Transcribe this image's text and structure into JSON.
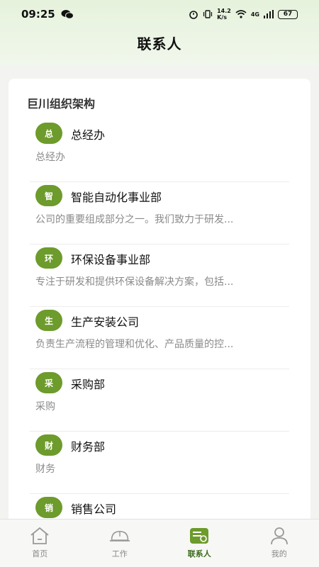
{
  "status": {
    "time": "09:25",
    "speed": "14.2\nK/s",
    "network": "4G",
    "battery": "67"
  },
  "header": {
    "title": "联系人"
  },
  "org": {
    "title": "巨川组织架构",
    "items": [
      {
        "badge": "总",
        "name": "总经办",
        "desc": "总经办"
      },
      {
        "badge": "智",
        "name": "智能自动化事业部",
        "desc": "公司的重要组成部分之一。我们致力于研发..."
      },
      {
        "badge": "环",
        "name": "环保设备事业部",
        "desc": "专注于研发和提供环保设备解决方案，包括..."
      },
      {
        "badge": "生",
        "name": "生产安装公司",
        "desc": "负责生产流程的管理和优化、产品质量的控..."
      },
      {
        "badge": "采",
        "name": "采购部",
        "desc": "采购"
      },
      {
        "badge": "财",
        "name": "财务部",
        "desc": "财务"
      },
      {
        "badge": "销",
        "name": "销售公司",
        "desc": ""
      }
    ]
  },
  "tabbar": {
    "tabs": [
      {
        "label": "首页",
        "icon": "home-icon"
      },
      {
        "label": "工作",
        "icon": "helmet-icon"
      },
      {
        "label": "联系人",
        "icon": "contacts-icon"
      },
      {
        "label": "我的",
        "icon": "user-icon"
      }
    ],
    "active": "联系人",
    "accent": "#6d9b2c"
  }
}
